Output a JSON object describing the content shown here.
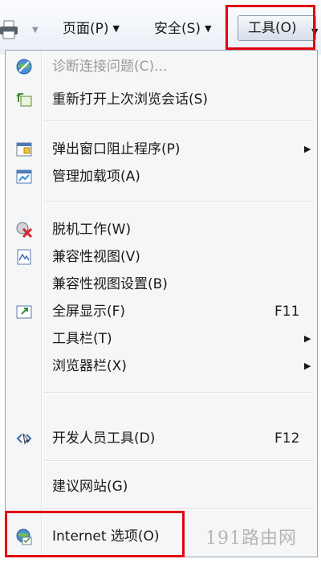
{
  "toolbar": {
    "printer_icon": "printer-icon",
    "items": [
      {
        "label": "页面(P)",
        "arrow": "▼"
      },
      {
        "label": "安全(S)",
        "arrow": "▼"
      },
      {
        "label": "工具(O)",
        "arrow": "▼"
      }
    ]
  },
  "menu": {
    "items": [
      {
        "label": "诊断连接问题(C)...",
        "icon": "globe-diagnose-icon",
        "disabled": true
      },
      {
        "label": "重新打开上次浏览会话(S)",
        "icon": "reopen-session-icon"
      },
      {
        "label": "弹出窗口阻止程序(P)",
        "icon": "popup-blocker-icon",
        "submenu": "▶"
      },
      {
        "label": "管理加载项(A)",
        "icon": "addons-icon"
      },
      {
        "label": "脱机工作(W)",
        "icon": "offline-icon"
      },
      {
        "label": "兼容性视图(V)",
        "icon": "compatibility-view-icon"
      },
      {
        "label": "兼容性视图设置(B)"
      },
      {
        "label": "全屏显示(F)",
        "icon": "fullscreen-icon",
        "shortcut": "F11"
      },
      {
        "label": "工具栏(T)",
        "submenu": "▶"
      },
      {
        "label": "浏览器栏(X)",
        "submenu": "▶"
      },
      {
        "label": "开发人员工具(D)",
        "icon": "developer-tools-icon",
        "shortcut": "F12"
      },
      {
        "label": "建议网站(G)"
      },
      {
        "label": "Internet 选项(O)",
        "icon": "internet-options-icon"
      }
    ]
  },
  "watermark": "191路由网",
  "colors": {
    "highlight": "#e3000f",
    "menu_bg": "#f5f6f7",
    "toolbar_bg": "#e9eef5"
  }
}
